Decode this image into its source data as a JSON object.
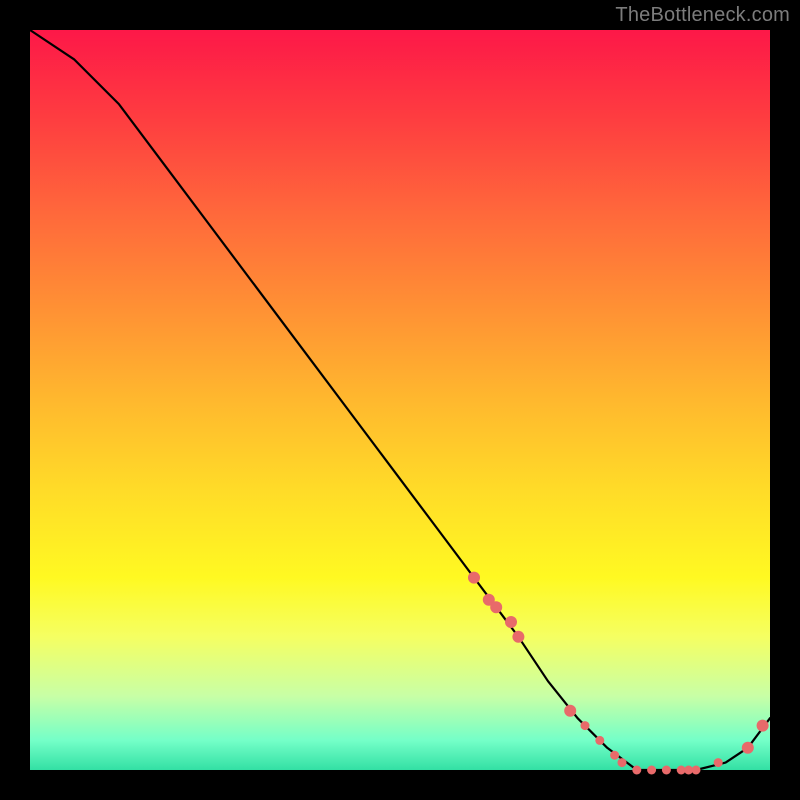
{
  "attribution": "TheBottleneck.com",
  "chart_data": {
    "type": "line",
    "x": [
      0.0,
      0.06,
      0.12,
      0.18,
      0.24,
      0.3,
      0.36,
      0.42,
      0.48,
      0.54,
      0.6,
      0.66,
      0.7,
      0.74,
      0.78,
      0.82,
      0.86,
      0.9,
      0.94,
      0.97,
      1.0
    ],
    "values": [
      100,
      96,
      90,
      82,
      74,
      66,
      58,
      50,
      42,
      34,
      26,
      18,
      12,
      7,
      3,
      0,
      0,
      0,
      1,
      3,
      7
    ],
    "title": "",
    "xlabel": "",
    "ylabel": "",
    "ylim": [
      0,
      100
    ],
    "markers": {
      "coral": {
        "x": [
          0.6,
          0.62,
          0.63,
          0.65,
          0.66,
          0.73,
          0.75,
          0.77,
          0.79,
          0.8,
          0.82,
          0.84,
          0.86,
          0.88,
          0.89,
          0.9,
          0.93,
          0.97,
          0.99
        ],
        "y": [
          26,
          23,
          22,
          20,
          18,
          8,
          6,
          4,
          2,
          1,
          0,
          0,
          0,
          0,
          0,
          0,
          1,
          3,
          6
        ]
      }
    },
    "colors": {
      "line": "#000000",
      "marker": "#e86a6a",
      "plot_top": "#fd1848",
      "plot_bottom": "#33e0a4"
    }
  }
}
